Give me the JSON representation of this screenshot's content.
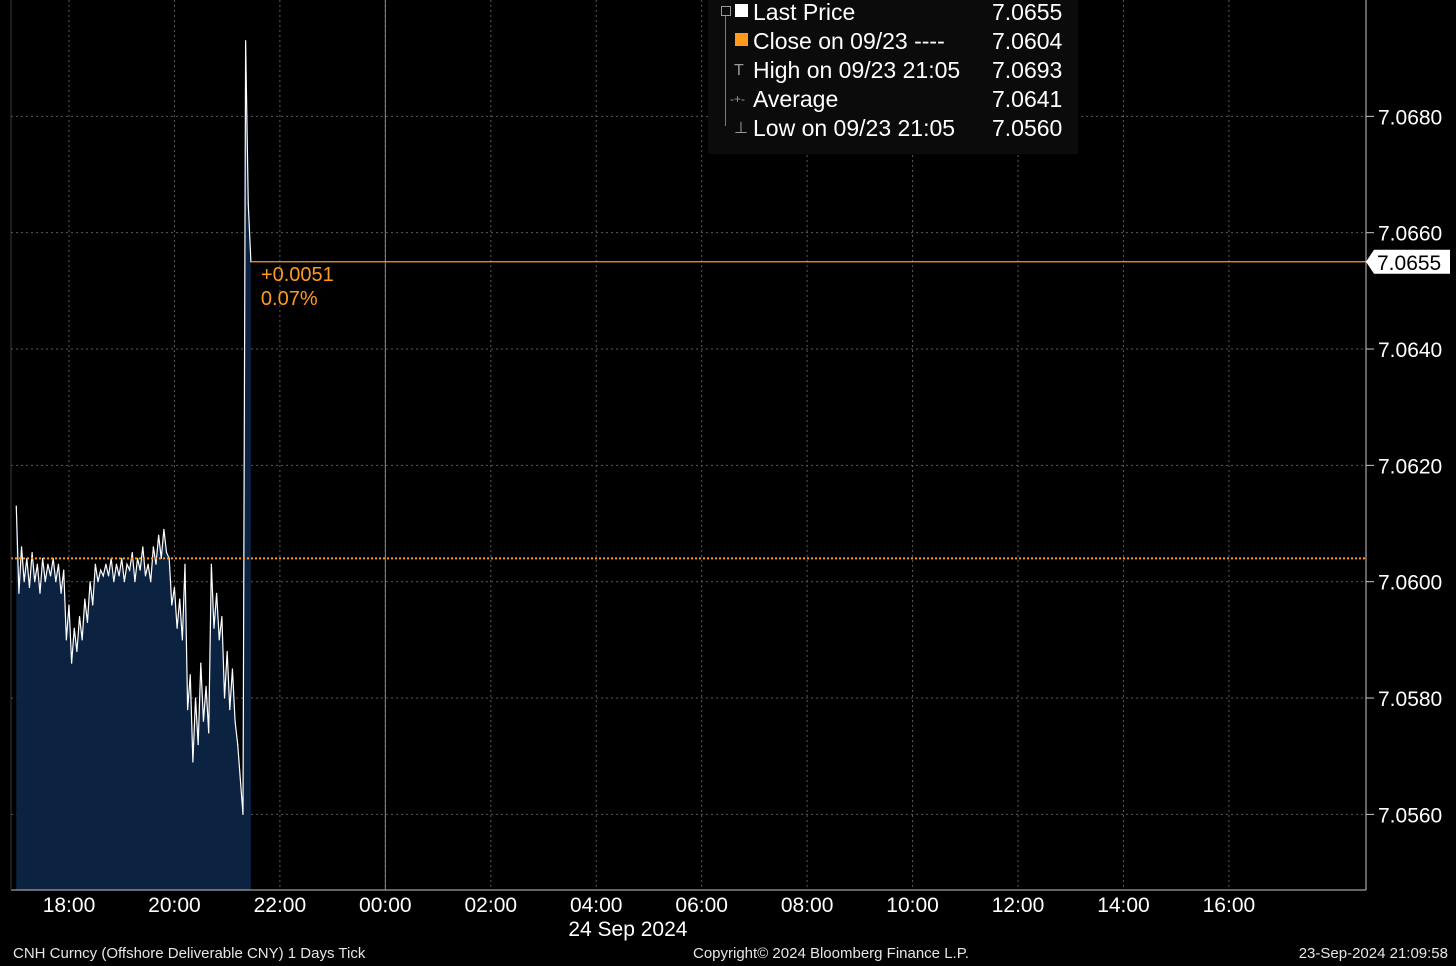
{
  "chart_data": {
    "type": "line",
    "x_axis": {
      "tick_labels": [
        "18:00",
        "20:00",
        "22:00",
        "00:00",
        "02:00",
        "04:00",
        "06:00",
        "08:00",
        "10:00",
        "12:00",
        "14:00",
        "16:00"
      ],
      "tick_hours": [
        -6,
        -4,
        -2,
        0,
        2,
        4,
        6,
        8,
        10,
        12,
        14,
        16
      ],
      "date_label": "24 Sep 2024",
      "range_hours": [
        -7.1,
        18.6
      ]
    },
    "y_axis": {
      "tick_labels": [
        "7.0560",
        "7.0580",
        "7.0600",
        "7.0620",
        "7.0640",
        "7.0660",
        "7.0680"
      ],
      "tick_values": [
        7.056,
        7.058,
        7.06,
        7.062,
        7.064,
        7.066,
        7.068
      ],
      "range": [
        7.0547,
        7.07
      ],
      "position": "right"
    },
    "grid": true,
    "series": [
      {
        "name": "Last Price",
        "color": "#ffffff",
        "fill": "#0b2240",
        "points": [
          [
            -7.0,
            7.0613
          ],
          [
            -6.95,
            7.0598
          ],
          [
            -6.9,
            7.0606
          ],
          [
            -6.85,
            7.06
          ],
          [
            -6.8,
            7.0604
          ],
          [
            -6.75,
            7.0599
          ],
          [
            -6.7,
            7.0605
          ],
          [
            -6.65,
            7.06
          ],
          [
            -6.6,
            7.0603
          ],
          [
            -6.55,
            7.0598
          ],
          [
            -6.5,
            7.0604
          ],
          [
            -6.45,
            7.06
          ],
          [
            -6.4,
            7.0603
          ],
          [
            -6.35,
            7.0601
          ],
          [
            -6.3,
            7.0604
          ],
          [
            -6.25,
            7.06
          ],
          [
            -6.2,
            7.0603
          ],
          [
            -6.15,
            7.0598
          ],
          [
            -6.1,
            7.0602
          ],
          [
            -6.05,
            7.059
          ],
          [
            -6.0,
            7.0596
          ],
          [
            -5.95,
            7.0586
          ],
          [
            -5.9,
            7.0592
          ],
          [
            -5.85,
            7.0588
          ],
          [
            -5.8,
            7.0594
          ],
          [
            -5.75,
            7.059
          ],
          [
            -5.7,
            7.0597
          ],
          [
            -5.65,
            7.0593
          ],
          [
            -5.6,
            7.06
          ],
          [
            -5.55,
            7.0596
          ],
          [
            -5.5,
            7.0603
          ],
          [
            -5.45,
            7.06
          ],
          [
            -5.4,
            7.0602
          ],
          [
            -5.35,
            7.0601
          ],
          [
            -5.3,
            7.0603
          ],
          [
            -5.25,
            7.0601
          ],
          [
            -5.2,
            7.0604
          ],
          [
            -5.15,
            7.06
          ],
          [
            -5.1,
            7.0603
          ],
          [
            -5.05,
            7.0601
          ],
          [
            -5.0,
            7.0604
          ],
          [
            -4.95,
            7.06
          ],
          [
            -4.9,
            7.0603
          ],
          [
            -4.85,
            7.0602
          ],
          [
            -4.8,
            7.0605
          ],
          [
            -4.75,
            7.06
          ],
          [
            -4.7,
            7.0604
          ],
          [
            -4.65,
            7.0602
          ],
          [
            -4.6,
            7.0606
          ],
          [
            -4.55,
            7.0601
          ],
          [
            -4.5,
            7.0603
          ],
          [
            -4.45,
            7.06
          ],
          [
            -4.4,
            7.0606
          ],
          [
            -4.35,
            7.0603
          ],
          [
            -4.3,
            7.0608
          ],
          [
            -4.25,
            7.0604
          ],
          [
            -4.2,
            7.0609
          ],
          [
            -4.15,
            7.0605
          ],
          [
            -4.1,
            7.0604
          ],
          [
            -4.05,
            7.0596
          ],
          [
            -4.0,
            7.0599
          ],
          [
            -3.95,
            7.0592
          ],
          [
            -3.9,
            7.0597
          ],
          [
            -3.85,
            7.059
          ],
          [
            -3.8,
            7.0603
          ],
          [
            -3.75,
            7.0578
          ],
          [
            -3.7,
            7.0584
          ],
          [
            -3.65,
            7.0569
          ],
          [
            -3.6,
            7.058
          ],
          [
            -3.55,
            7.0572
          ],
          [
            -3.5,
            7.0586
          ],
          [
            -3.45,
            7.0576
          ],
          [
            -3.4,
            7.0582
          ],
          [
            -3.35,
            7.0574
          ],
          [
            -3.3,
            7.0603
          ],
          [
            -3.25,
            7.0592
          ],
          [
            -3.2,
            7.0598
          ],
          [
            -3.15,
            7.059
          ],
          [
            -3.1,
            7.0594
          ],
          [
            -3.05,
            7.058
          ],
          [
            -3.0,
            7.0588
          ],
          [
            -2.95,
            7.0578
          ],
          [
            -2.9,
            7.0585
          ],
          [
            -2.85,
            7.0576
          ],
          [
            -2.8,
            7.0572
          ],
          [
            -2.75,
            7.0566
          ],
          [
            -2.7,
            7.056
          ],
          [
            -2.65,
            7.0693
          ],
          [
            -2.6,
            7.0665
          ],
          [
            -2.55,
            7.0655
          ]
        ]
      }
    ],
    "reference_lines": [
      {
        "name": "Close on 09/23",
        "value": 7.0604,
        "color": "#ff9a1f",
        "style": "dotted"
      },
      {
        "name": "Last Price",
        "value": 7.0655,
        "color": "#ff9a1f",
        "style": "solid"
      }
    ],
    "annotations": [
      {
        "text": "+0.0051",
        "color": "#ff9a1f"
      },
      {
        "text": "0.07%",
        "color": "#ff9a1f"
      }
    ],
    "current_value_label": "7.0655",
    "day_divider_hour": 0
  },
  "legend": [
    {
      "label": "Last Price",
      "value": "7.0655",
      "marker": "white-square-icon",
      "color": "#ffffff"
    },
    {
      "label": "Close on 09/23 ----",
      "value": "7.0604",
      "marker": "orange-square-icon",
      "color": "#ff9a1f"
    },
    {
      "label": "High on 09/23 21:05",
      "value": "7.0693",
      "marker": "high-tick-icon",
      "glyph": "T"
    },
    {
      "label": "Average",
      "value": "7.0641",
      "marker": "average-dot-icon",
      "glyph": "-+-"
    },
    {
      "label": "Low on 09/23 21:05",
      "value": "7.0560",
      "marker": "low-tick-icon",
      "glyph": "⊥"
    }
  ],
  "footer": {
    "left": "CNH Curncy (Offshore Deliverable CNY) 1 Days  Tick",
    "center": "Copyright© 2024 Bloomberg Finance L.P.",
    "right": "23-Sep-2024 21:09:58"
  }
}
